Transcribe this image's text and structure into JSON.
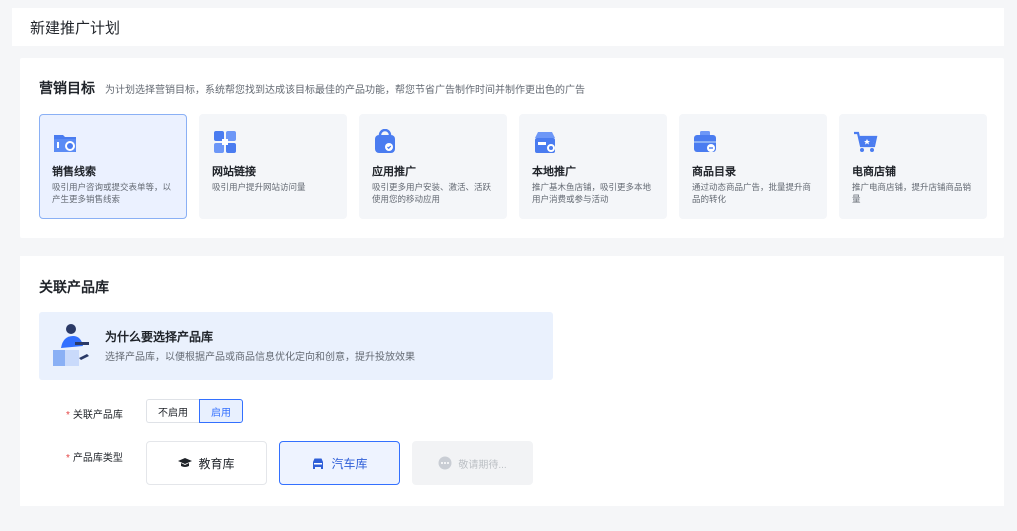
{
  "page": {
    "title": "新建推广计划"
  },
  "goal_section": {
    "title": "营销目标",
    "description": "为计划选择营销目标，系统帮您找到达成该目标最佳的产品功能，帮您节省广告制作时间并制作更出色的广告",
    "items": [
      {
        "title": "销售线索",
        "desc": "吸引用户咨询或提交表单等，以产生更多销售线索",
        "icon": "sales-leads-icon",
        "selected": true
      },
      {
        "title": "网站链接",
        "desc": "吸引用户提升网站访问量",
        "icon": "website-link-icon",
        "selected": false
      },
      {
        "title": "应用推广",
        "desc": "吸引更多用户安装、激活、活跃使用您的移动应用",
        "icon": "app-promotion-icon",
        "selected": false
      },
      {
        "title": "本地推广",
        "desc": "推广基木鱼店铺，吸引更多本地用户消费或参与活动",
        "icon": "local-store-icon",
        "selected": false
      },
      {
        "title": "商品目录",
        "desc": "通过动态商品广告，批量提升商品的转化",
        "icon": "product-catalog-icon",
        "selected": false
      },
      {
        "title": "电商店铺",
        "desc": "推广电商店铺，提升店铺商品销量",
        "icon": "ecommerce-cart-icon",
        "selected": false
      }
    ]
  },
  "library_section": {
    "title": "关联产品库",
    "tip": {
      "title": "为什么要选择产品库",
      "desc": "选择产品库，以便根据产品或商品信息优化定向和创意，提升投放效果"
    },
    "link_field": {
      "required_mark": "*",
      "label": "关联产品库",
      "options": [
        "不启用",
        "启用"
      ],
      "selected": "启用"
    },
    "type_field": {
      "required_mark": "*",
      "label": "产品库类型",
      "options": [
        {
          "label": "教育库",
          "icon": "graduation-cap-icon",
          "state": "normal"
        },
        {
          "label": "汽车库",
          "icon": "car-icon",
          "state": "selected"
        },
        {
          "label": "敬请期待...",
          "icon": "more-dots-icon",
          "state": "disabled"
        }
      ]
    }
  },
  "colors": {
    "accent": "#3370ff",
    "selected_bg": "#ebf1ff",
    "required": "#e54545"
  }
}
